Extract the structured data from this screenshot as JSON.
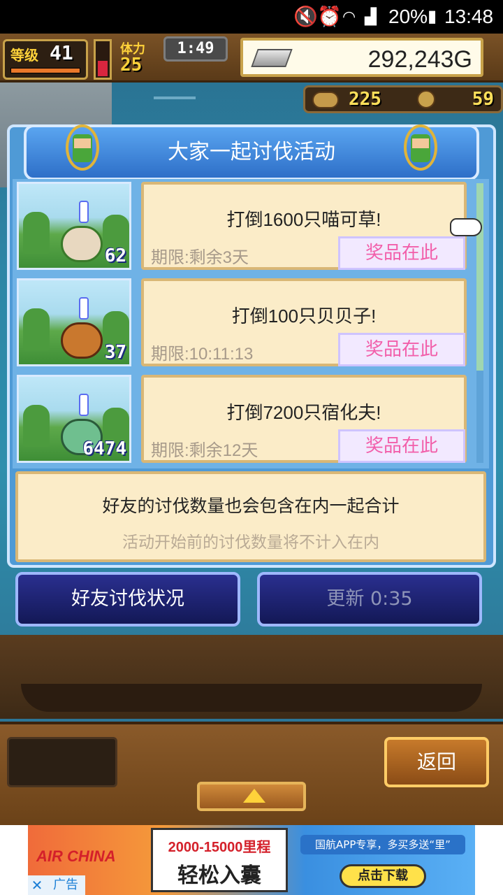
{
  "status_bar": {
    "battery": "20%",
    "time": "13:48"
  },
  "hud": {
    "level_label": "等级",
    "level": "41",
    "stamina_label": "体力",
    "stamina": "25",
    "timer": "1:49",
    "gold": "292,243G",
    "resource_1": "225",
    "resource_2": "59"
  },
  "dialog": {
    "title": "大家一起讨伐活动",
    "events": [
      {
        "title": "打倒1600只喵可草!",
        "deadline": "期限:剩余3天",
        "prize_label": "奖品在此",
        "count": "62"
      },
      {
        "title": "打倒100只贝贝子!",
        "deadline": "期限:10:11:13",
        "prize_label": "奖品在此",
        "count": "37"
      },
      {
        "title": "打倒7200只宿化夫!",
        "deadline": "期限:剩余12天",
        "prize_label": "奖品在此",
        "count": "6474"
      }
    ],
    "info_line1": "好友的讨伐数量也会包含在内一起合计",
    "info_line2": "活动开始前的讨伐数量将不计入在内",
    "friends_button": "好友讨伐状况",
    "refresh_button": "更新 0:35"
  },
  "bottom": {
    "back_button": "返回"
  },
  "ad": {
    "brand": "AIR CHINA",
    "miles": "2000-15000里程",
    "slogan": "轻松入囊",
    "promo": "国航APP专享，多买多送“里”",
    "download": "点击下载",
    "close": "✕",
    "tag": "广告"
  },
  "colors": {
    "accent_blue": "#4f9ad6",
    "prize_text": "#f25faa",
    "card_bg": "#fbecc8"
  }
}
